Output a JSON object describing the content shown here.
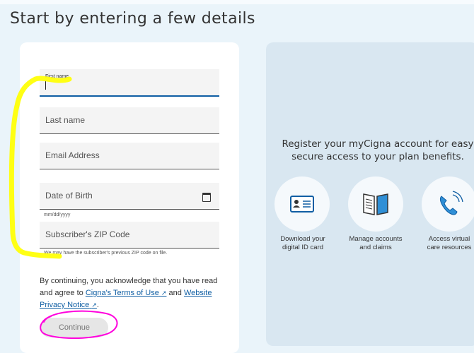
{
  "header": {
    "title": "Start by entering a few details"
  },
  "form": {
    "first_name": {
      "label": "First name",
      "value": ""
    },
    "last_name": {
      "label": "Last name"
    },
    "email": {
      "label": "Email Address"
    },
    "dob": {
      "label": "Date of Birth",
      "hint": "mm/dd/yyyy"
    },
    "zip": {
      "label": "Subscriber's ZIP Code",
      "hint": "We may have the subscriber's previous ZIP code on file."
    },
    "consent": {
      "prefix": "By continuing, you acknowledge that you have read and agree to",
      "terms_link": "Cigna's Terms of Use",
      "and": "and",
      "privacy_link": "Website Privacy Notice",
      "end": "."
    },
    "continue_label": "Continue"
  },
  "panel": {
    "title": "Register your myCigna account for easy secure access to your plan benefits.",
    "features": [
      {
        "icon": "id-card-icon",
        "line1": "Download your",
        "line2": "digital ID card"
      },
      {
        "icon": "open-book-icon",
        "line1": "Manage accounts",
        "line2": "and claims"
      },
      {
        "icon": "phone-icon",
        "line1": "Access virtual",
        "line2": "care resources"
      }
    ]
  },
  "colors": {
    "accent": "#0f5ea3",
    "highlighter": "#ffff00",
    "pen": "#ff00dd",
    "panel_bg": "#d9e7f1"
  }
}
